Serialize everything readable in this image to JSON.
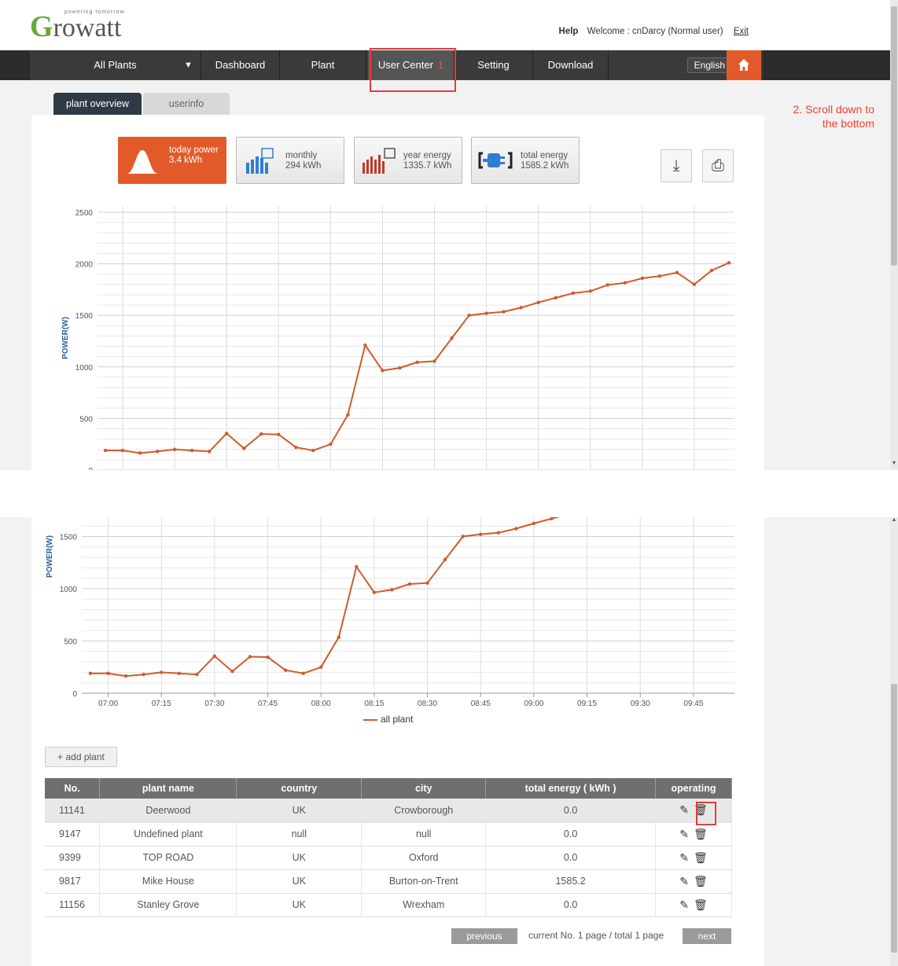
{
  "header": {
    "logo_text": "rowatt",
    "logo_g": "G",
    "tagline": "powering tomorrow",
    "help": "Help",
    "welcome": "Welcome : cnDarcy (Normal user)",
    "exit": "Exit"
  },
  "nav": {
    "items": [
      "All Plants",
      "Dashboard",
      "Plant",
      "User Center",
      "Setting",
      "Download"
    ],
    "dropdown_arrow": "▼",
    "active_number": "1",
    "language": "English ⦿",
    "home_icon": "⌂"
  },
  "tabs": [
    "plant overview",
    "userinfo"
  ],
  "annotation": "2. Scroll down to the bottom",
  "energy_buttons": [
    {
      "label": "today power",
      "value": "3.4 kWh",
      "icon": "sun-curve-icon"
    },
    {
      "label": "monthly",
      "value": "294 kWh",
      "icon": "monthly-bars-icon"
    },
    {
      "label": "year energy",
      "value": "1335.7 kWh",
      "icon": "year-bars-icon"
    },
    {
      "label": "total energy",
      "value": "1585.2 kWh",
      "icon": "plug-icon"
    }
  ],
  "tools": {
    "download_icon": "⤓",
    "print_icon": "⎙"
  },
  "chart_data": {
    "type": "line",
    "ylabel": "POWER(W)",
    "ylim": [
      0,
      2500
    ],
    "yticks": [
      0,
      500,
      1000,
      1500,
      2000,
      2500
    ],
    "xticks": [
      "07:00",
      "07:15",
      "07:30",
      "07:45",
      "08:00",
      "08:15",
      "08:30",
      "08:45",
      "09:00",
      "09:15",
      "09:30",
      "09:45"
    ],
    "series": [
      {
        "name": "all plant",
        "color": "#d15a2c",
        "x": [
          "06:55",
          "07:00",
          "07:05",
          "07:10",
          "07:15",
          "07:20",
          "07:25",
          "07:30",
          "07:35",
          "07:40",
          "07:45",
          "07:50",
          "07:55",
          "08:00",
          "08:05",
          "08:10",
          "08:15",
          "08:20",
          "08:25",
          "08:30",
          "08:35",
          "08:40",
          "08:45",
          "08:50",
          "08:55",
          "09:00",
          "09:05",
          "09:10",
          "09:15",
          "09:20",
          "09:25",
          "09:30",
          "09:35",
          "09:40",
          "09:45",
          "09:50",
          "09:55"
        ],
        "values": [
          190,
          190,
          165,
          180,
          200,
          190,
          180,
          355,
          210,
          350,
          345,
          220,
          190,
          250,
          535,
          1210,
          965,
          990,
          1045,
          1055,
          1280,
          1500,
          1520,
          1535,
          1575,
          1625,
          1670,
          1715,
          1735,
          1795,
          1815,
          1860,
          1880,
          1915,
          1800,
          1935,
          2010
        ]
      }
    ]
  },
  "add_plant": "+ add plant",
  "table": {
    "headers": [
      "No.",
      "plant name",
      "country",
      "city",
      "total energy ( kWh )",
      "operating"
    ],
    "rows": [
      [
        "11141",
        "Deerwood",
        "UK",
        "Crowborough",
        "0.0"
      ],
      [
        "9147",
        "Undefined plant",
        "null",
        "null",
        "0.0"
      ],
      [
        "9399",
        "TOP ROAD",
        "UK",
        "Oxford",
        "0.0"
      ],
      [
        "9817",
        "Mike House",
        "UK",
        "Burton-on-Trent",
        "1585.2"
      ],
      [
        "11156",
        "Stanley Grove",
        "UK",
        "Wrexham",
        "0.0"
      ]
    ],
    "edit_icon": "✎",
    "delete_icon": "🗑"
  },
  "pager": {
    "previous": "previous",
    "info": "current  No. 1 page / total 1 page",
    "next": "next"
  }
}
